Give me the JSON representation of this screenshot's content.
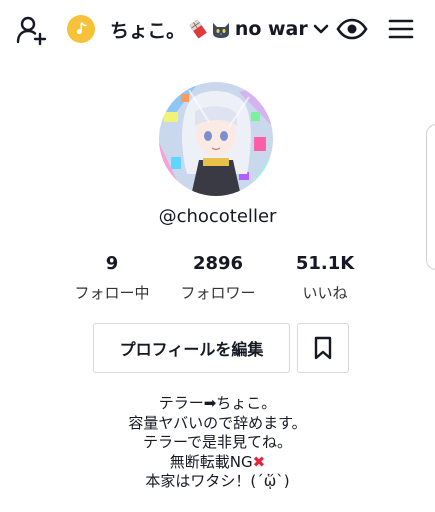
{
  "header": {
    "title": "ちょこ。",
    "title_suffix": "no war",
    "icons": [
      "add-user-icon",
      "coin-icon",
      "chocolate-emoji",
      "black-cat-emoji",
      "chevron-down-icon",
      "eye-icon",
      "menu-icon"
    ]
  },
  "profile": {
    "username": "@chocoteller"
  },
  "stats": [
    {
      "value": "9",
      "label": "フォロー中"
    },
    {
      "value": "2896",
      "label": "フォロワー"
    },
    {
      "value": "51.1K",
      "label": "いいね"
    }
  ],
  "actions": {
    "edit_profile_label": "プロフィールを編集"
  },
  "bio": {
    "line1": "テラー➡ちょこ。",
    "line2": "容量ヤバいので辞めます。",
    "line3": "テラーで是非見てね。",
    "line4": "無断転載NG",
    "line4_mark": "✖",
    "line5": "本家はワタシ！(´ᾥ`)"
  },
  "colors": {
    "accent_red": "#e3253c",
    "coin": "#f7c23a",
    "text": "#161823",
    "border": "#d9d9d9"
  }
}
